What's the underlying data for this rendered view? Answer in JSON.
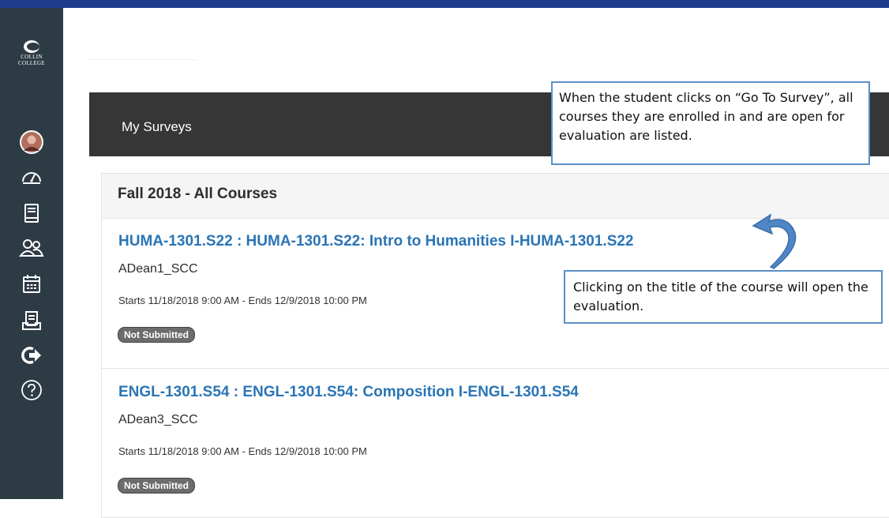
{
  "sidebar": {
    "logo_lines": [
      "COLLIN",
      "COLLEGE"
    ],
    "items": [
      {
        "icon": "avatar"
      },
      {
        "icon": "dashboard-icon"
      },
      {
        "icon": "courses-icon"
      },
      {
        "icon": "groups-icon"
      },
      {
        "icon": "calendar-icon"
      },
      {
        "icon": "inbox-icon"
      },
      {
        "icon": "logout-icon"
      },
      {
        "icon": "help-icon"
      }
    ]
  },
  "header": {
    "title": "My Surveys"
  },
  "callouts": {
    "go_to_survey": "When the student clicks on “Go To Survey”, all courses they are enrolled in and are open for evaluation are listed.",
    "title_click": "Clicking on the title of the course will open the evaluation."
  },
  "term": {
    "title": "Fall 2018 - All Courses"
  },
  "courses": [
    {
      "title": "HUMA-1301.S22 : HUMA-1301.S22: Intro to Humanities I-HUMA-1301.S22",
      "instructor": "ADean1_SCC",
      "dates": "Starts 11/18/2018 9:00 AM - Ends 12/9/2018 10:00 PM",
      "status": "Not Submitted"
    },
    {
      "title": "ENGL-1301.S54 : ENGL-1301.S54: Composition I-ENGL-1301.S54",
      "instructor": "ADean3_SCC",
      "dates": "Starts 11/18/2018 9:00 AM - Ends 12/9/2018 10:00 PM",
      "status": "Not Submitted"
    }
  ],
  "colors": {
    "sidebar": "#2d3b45",
    "header": "#363636",
    "link": "#2a74b5",
    "callout_border": "#5b8fc7",
    "arrow": "#4f86c6"
  }
}
